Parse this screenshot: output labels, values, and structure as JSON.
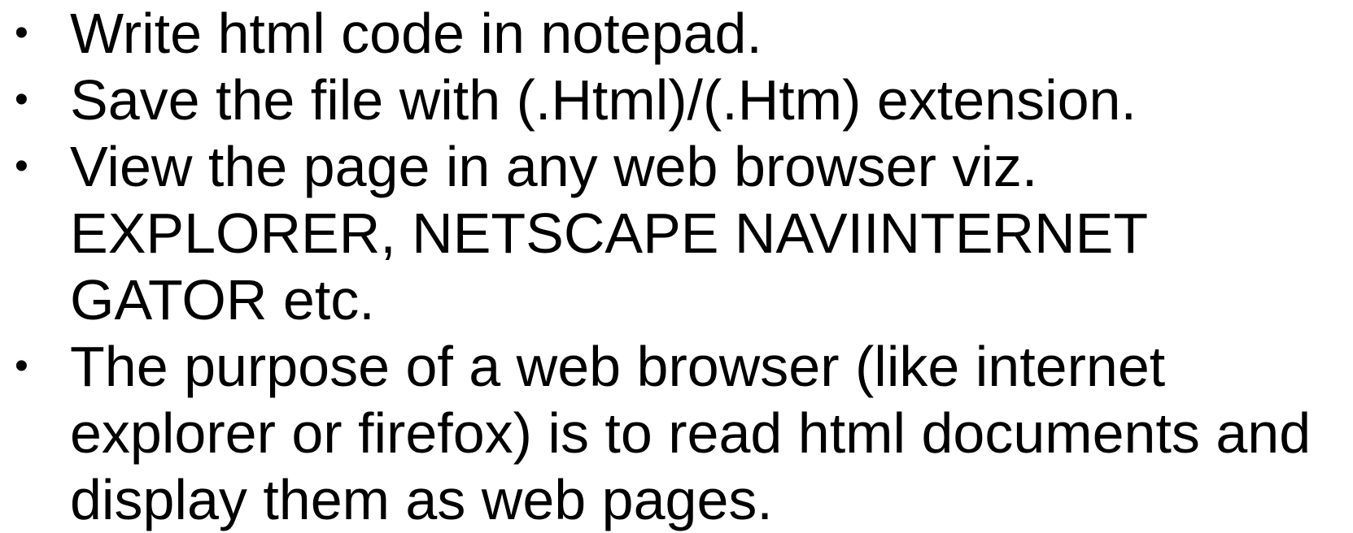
{
  "bullet_glyph": "•",
  "bullets": [
    {
      "lines": [
        "Write html code in notepad."
      ]
    },
    {
      "lines": [
        "Save the file with (.Html)/(.Htm) extension."
      ]
    },
    {
      "lines": [
        "View the page in any web browser viz.",
        "EXPLORER, NETSCAPE NAVIINTERNET",
        "GATOR etc."
      ]
    },
    {
      "lines": [
        "The purpose of a web browser (like internet",
        "explorer or firefox) is to read html documents and",
        "display them as web pages."
      ]
    }
  ]
}
